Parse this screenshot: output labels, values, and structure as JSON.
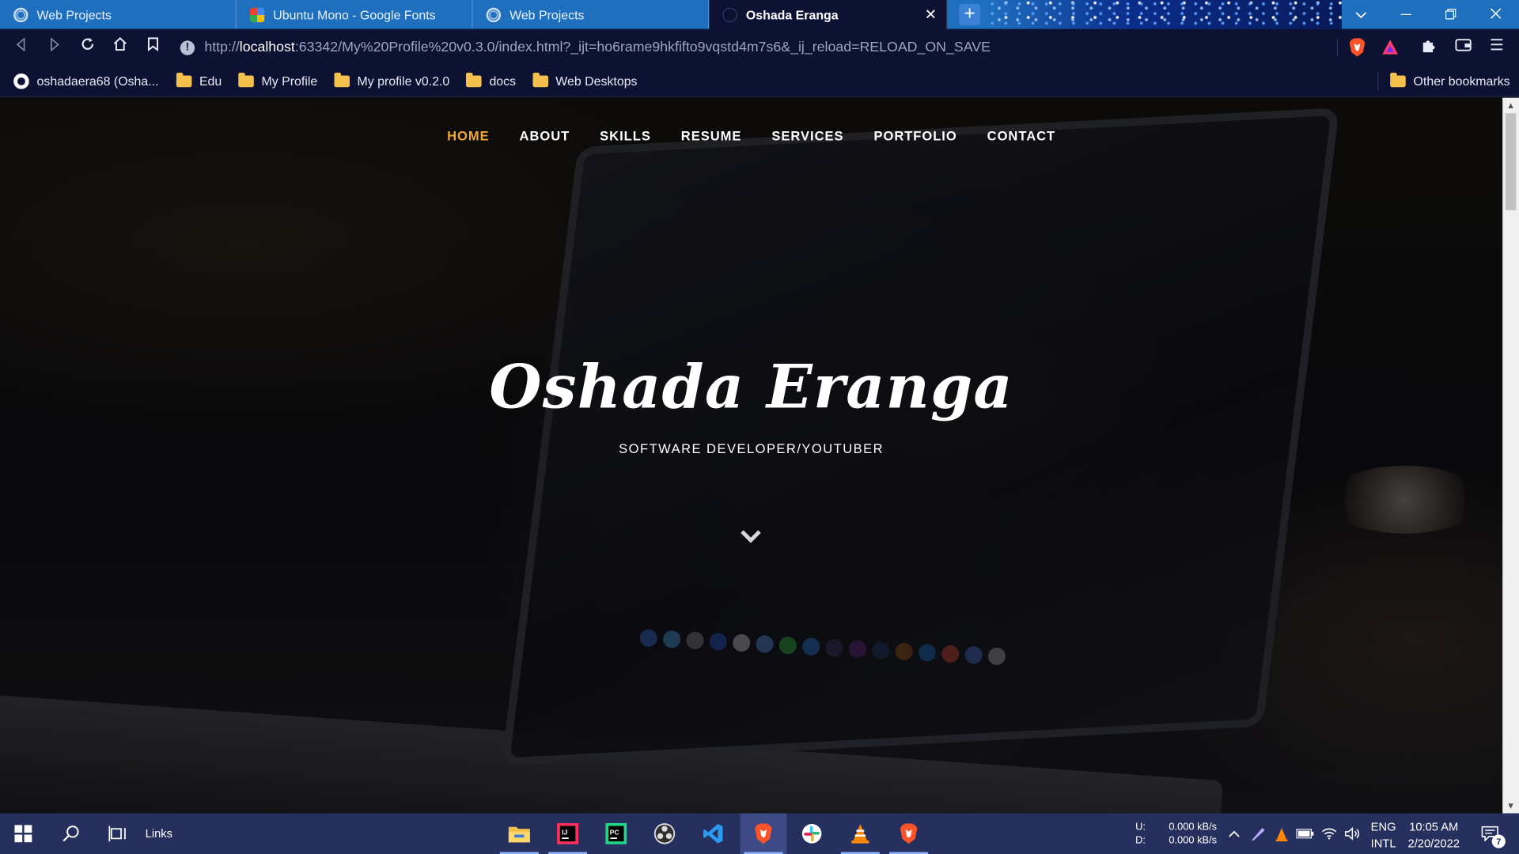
{
  "browser": {
    "tabs": [
      {
        "title": "Web Projects",
        "icon": "globe-icon"
      },
      {
        "title": "Ubuntu Mono - Google Fonts",
        "icon": "google-fonts-icon"
      },
      {
        "title": "Web Projects",
        "icon": "globe-icon"
      },
      {
        "title": "Oshada Eranga",
        "icon": "site-icon",
        "active": true
      }
    ],
    "close_glyph": "✕",
    "new_tab_glyph": "+",
    "url": {
      "scheme": "http://",
      "host": "localhost",
      "rest": ":63342/My%20Profile%20v0.3.0/index.html?_ijt=ho6rame9hkfifto9vqstd4m7s6&_ij_reload=RELOAD_ON_SAVE"
    },
    "bookmarks": [
      {
        "label": "oshadaera68 (Osha...",
        "icon": "github-icon"
      },
      {
        "label": "Edu",
        "icon": "folder-icon"
      },
      {
        "label": "My Profile",
        "icon": "folder-icon"
      },
      {
        "label": "My profile v0.2.0",
        "icon": "folder-icon"
      },
      {
        "label": "docs",
        "icon": "folder-icon"
      },
      {
        "label": "Web Desktops",
        "icon": "folder-icon"
      }
    ],
    "other_bookmarks": "Other bookmarks"
  },
  "site": {
    "nav": [
      "HOME",
      "ABOUT",
      "SKILLS",
      "RESUME",
      "SERVICES",
      "PORTFOLIO",
      "CONTACT"
    ],
    "active_nav": "HOME",
    "accent_color": "#f2a833",
    "name": "Oshada Eranga",
    "subtitle": "SOFTWARE DEVELOPER/YOUTUBER",
    "scroll_icon": "chevron-down-icon"
  },
  "taskbar": {
    "links_label": "Links",
    "net_upload_label": "U:",
    "net_download_label": "D:",
    "net_upload": "0.000 kB/s",
    "net_download": "0.000 kB/s",
    "language": "ENG",
    "layout": "INTL",
    "time": "10:05 AM",
    "date": "2/20/2022",
    "notifications": "7",
    "apps": [
      "file-explorer-icon",
      "intellij-icon",
      "pycharm-icon",
      "obs-icon",
      "vscode-icon",
      "brave-icon",
      "slack-icon",
      "vlc-icon",
      "brave-icon"
    ]
  }
}
